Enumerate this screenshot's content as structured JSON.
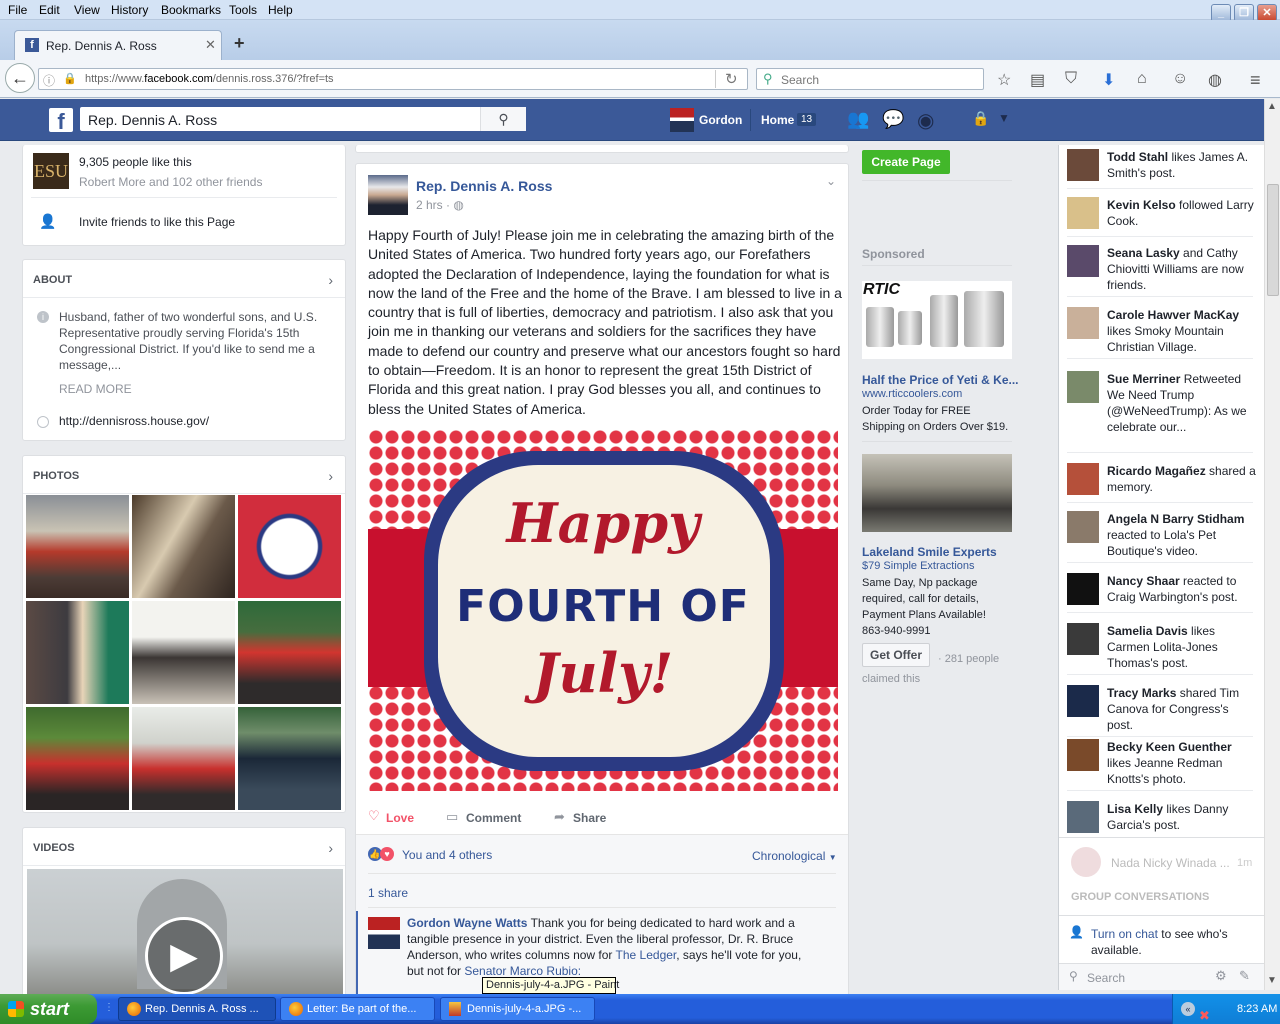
{
  "menu": [
    "File",
    "Edit",
    "View",
    "History",
    "Bookmarks",
    "Tools",
    "Help"
  ],
  "tab": {
    "title": "Rep. Dennis A. Ross",
    "new_tab": "+"
  },
  "url": {
    "prefix": "https://www.",
    "domain": "facebook.com",
    "path": "/dennis.ross.376/?fref=ts"
  },
  "browser_search_placeholder": "Search",
  "fb": {
    "search_value": "Rep. Dennis A. Ross",
    "user": "Gordon",
    "home": "Home",
    "home_count": "13"
  },
  "left": {
    "likes": "9,305 people like this",
    "friends_like": "Robert More and 102 other friends",
    "invite": "Invite friends to like this Page",
    "about_title": "ABOUT",
    "about_text": "Husband, father of two wonderful sons, and U.S. Representative proudly serving Florida's 15th Congressional District. If you'd like to send me a message,...",
    "read_more": "READ MORE",
    "website": "http://dennisross.house.gov/",
    "photos_title": "PHOTOS",
    "videos_title": "VIDEOS"
  },
  "post": {
    "author": "Rep. Dennis A. Ross",
    "time": "2 hrs · ",
    "text": "Happy Fourth of July! Please join me in celebrating the amazing birth of the United States of America. Two hundred forty years ago, our Forefathers adopted the Declaration of Independence, laying the foundation for what is now the land of the Free and the home of the Brave. I am blessed to live in a country that is full of liberties, democracy and patriotism. I also ask that you join me in thanking our veterans and soldiers for the sacrifices they have made to defend our country and preserve what our ancestors fought so hard to obtain—Freedom. It is an honor to represent the great 15th District of Florida and this great nation. I pray God blesses you all, and continues to bless the United States of America.",
    "image_line1": "Happy",
    "image_line2": "FOURTH OF",
    "image_line3": "July!",
    "love": "Love",
    "comment": "Comment",
    "share": "Share",
    "reactions": "You and 4 others",
    "order": "Chronological",
    "shares": "1 share",
    "commenter": "Gordon Wayne Watts",
    "comment_text_1": " Thank you for being dedicated to hard work and a tangible presence in your district. Even the liberal professor, Dr. R. Bruce Anderson, who writes columns now for ",
    "comment_link_1": "The Ledger",
    "comment_text_2": ", says he'll vote for you, but not for ",
    "comment_link_2": "Senator Marco Rubio:"
  },
  "ads": {
    "create_page": "Create Page",
    "sponsored": "Sponsored",
    "ad1_logo": "RTIC",
    "ad1_title": "Half the Price of Yeti & Ke...",
    "ad1_url": "www.rticcoolers.com",
    "ad1_text": "Order Today for FREE Shipping on Orders Over $19.",
    "ad2_title": "Lakeland Smile Experts",
    "ad2_sub": "$79 Simple Extractions",
    "ad2_text": "Same Day, Np package required, call for details, Payment Plans Available! 863-940-9991",
    "ad2_btn": "Get Offer",
    "ad2_claimed": "· 281 people claimed this"
  },
  "ticker": [
    {
      "name": "Todd Stahl",
      "rest": " likes James A. Smith's post."
    },
    {
      "name": "Kevin Kelso",
      "rest": " followed Larry Cook."
    },
    {
      "name": "Seana Lasky",
      "rest": " and Cathy Chiovitti Williams are now friends."
    },
    {
      "name": "Carole Hawver MacKay",
      "rest": " likes Smoky Mountain Christian Village."
    },
    {
      "name": "Sue Merriner",
      "rest": " Retweeted We Need Trump (@WeNeedTrump):  As we celebrate our..."
    },
    {
      "name": "Ricardo Magañez",
      "rest": " shared a memory."
    },
    {
      "name": "Angela N Barry Stidham",
      "rest": " reacted to Lola's Pet Boutique's video."
    },
    {
      "name": "Nancy Shaar",
      "rest": " reacted to Craig Warbington's post."
    },
    {
      "name": "Samelia Davis",
      "rest": " likes Carmen Lolita-Jones Thomas's post."
    },
    {
      "name": "Tracy Marks",
      "rest": " shared Tim Canova for Congress's post."
    },
    {
      "name": "Becky Keen Guenther",
      "rest": " likes Jeanne Redman Knotts's photo."
    },
    {
      "name": "Lisa Kelly",
      "rest": " likes Danny Garcia's post."
    }
  ],
  "chat": {
    "contact": "Nada Nicky Winada ...",
    "contact_time": "1m",
    "group_title": "GROUP CONVERSATIONS",
    "turn_on": "Turn on chat",
    "turn_on_rest": " to see who's available.",
    "search_placeholder": "Search"
  },
  "taskbar": {
    "start": "start",
    "items": [
      "Rep. Dennis A. Ross ...",
      "Letter: Be part of the...",
      "Dennis-july-4-a.JPG -..."
    ],
    "time": "8:23 AM",
    "tooltip": "Dennis-july-4-a.JPG - Paint"
  },
  "colors": {
    "fb_blue": "#3b5998",
    "create_green": "#42b72a",
    "love_red": "#f25268"
  }
}
